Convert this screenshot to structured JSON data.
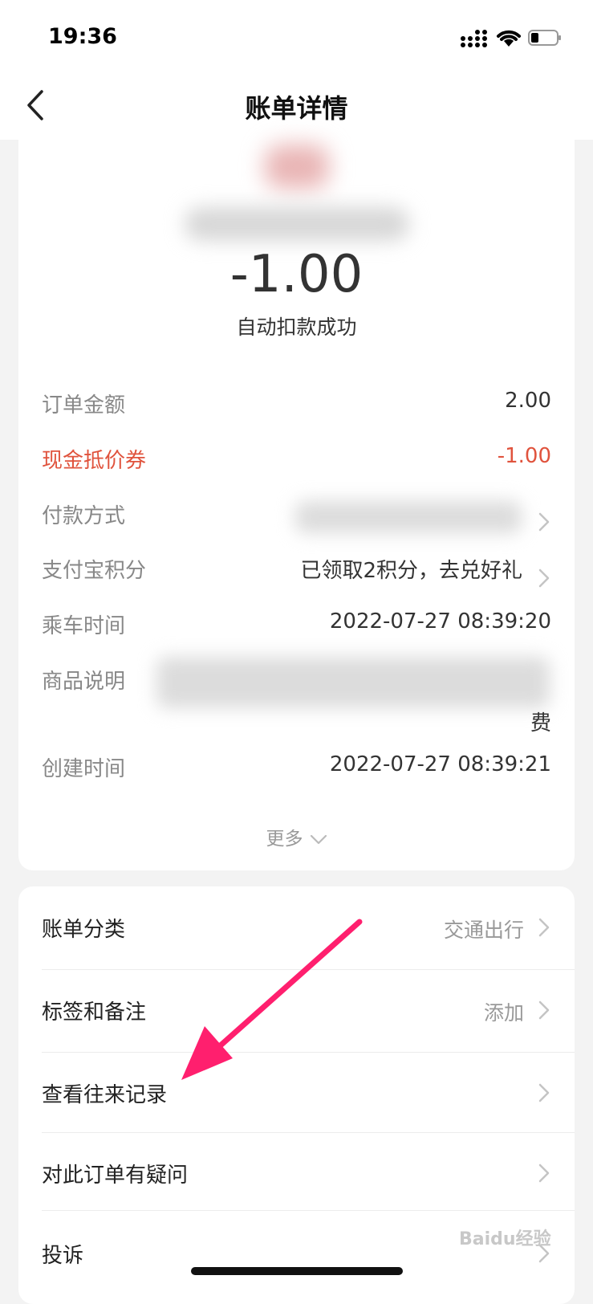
{
  "status_bar": {
    "time": "19:36"
  },
  "header": {
    "title": "账单详情"
  },
  "summary": {
    "amount": "-1.00",
    "status": "自动扣款成功"
  },
  "details": {
    "order_amount": {
      "label": "订单金额",
      "value": "2.00"
    },
    "coupon": {
      "label": "现金抵价券",
      "value": "-1.00",
      "color": "#e0533d"
    },
    "payment_method": {
      "label": "付款方式"
    },
    "points": {
      "label": "支付宝积分",
      "value": "已领取2积分，去兑好礼"
    },
    "ride_time": {
      "label": "乘车时间",
      "value": "2022-07-27 08:39:20"
    },
    "product_desc": {
      "label": "商品说明",
      "value_tail": "费"
    },
    "create_time": {
      "label": "创建时间",
      "value": "2022-07-27 08:39:21"
    },
    "more_label": "更多"
  },
  "actions": {
    "category": {
      "label": "账单分类",
      "value": "交通出行"
    },
    "tags": {
      "label": "标签和备注",
      "value": "添加"
    },
    "history": {
      "label": "查看往来记录"
    },
    "question": {
      "label": "对此订单有疑问"
    },
    "complaint": {
      "label": "投诉"
    }
  },
  "annotation_color": "#ff1f6e",
  "watermark": "Baidu经验"
}
